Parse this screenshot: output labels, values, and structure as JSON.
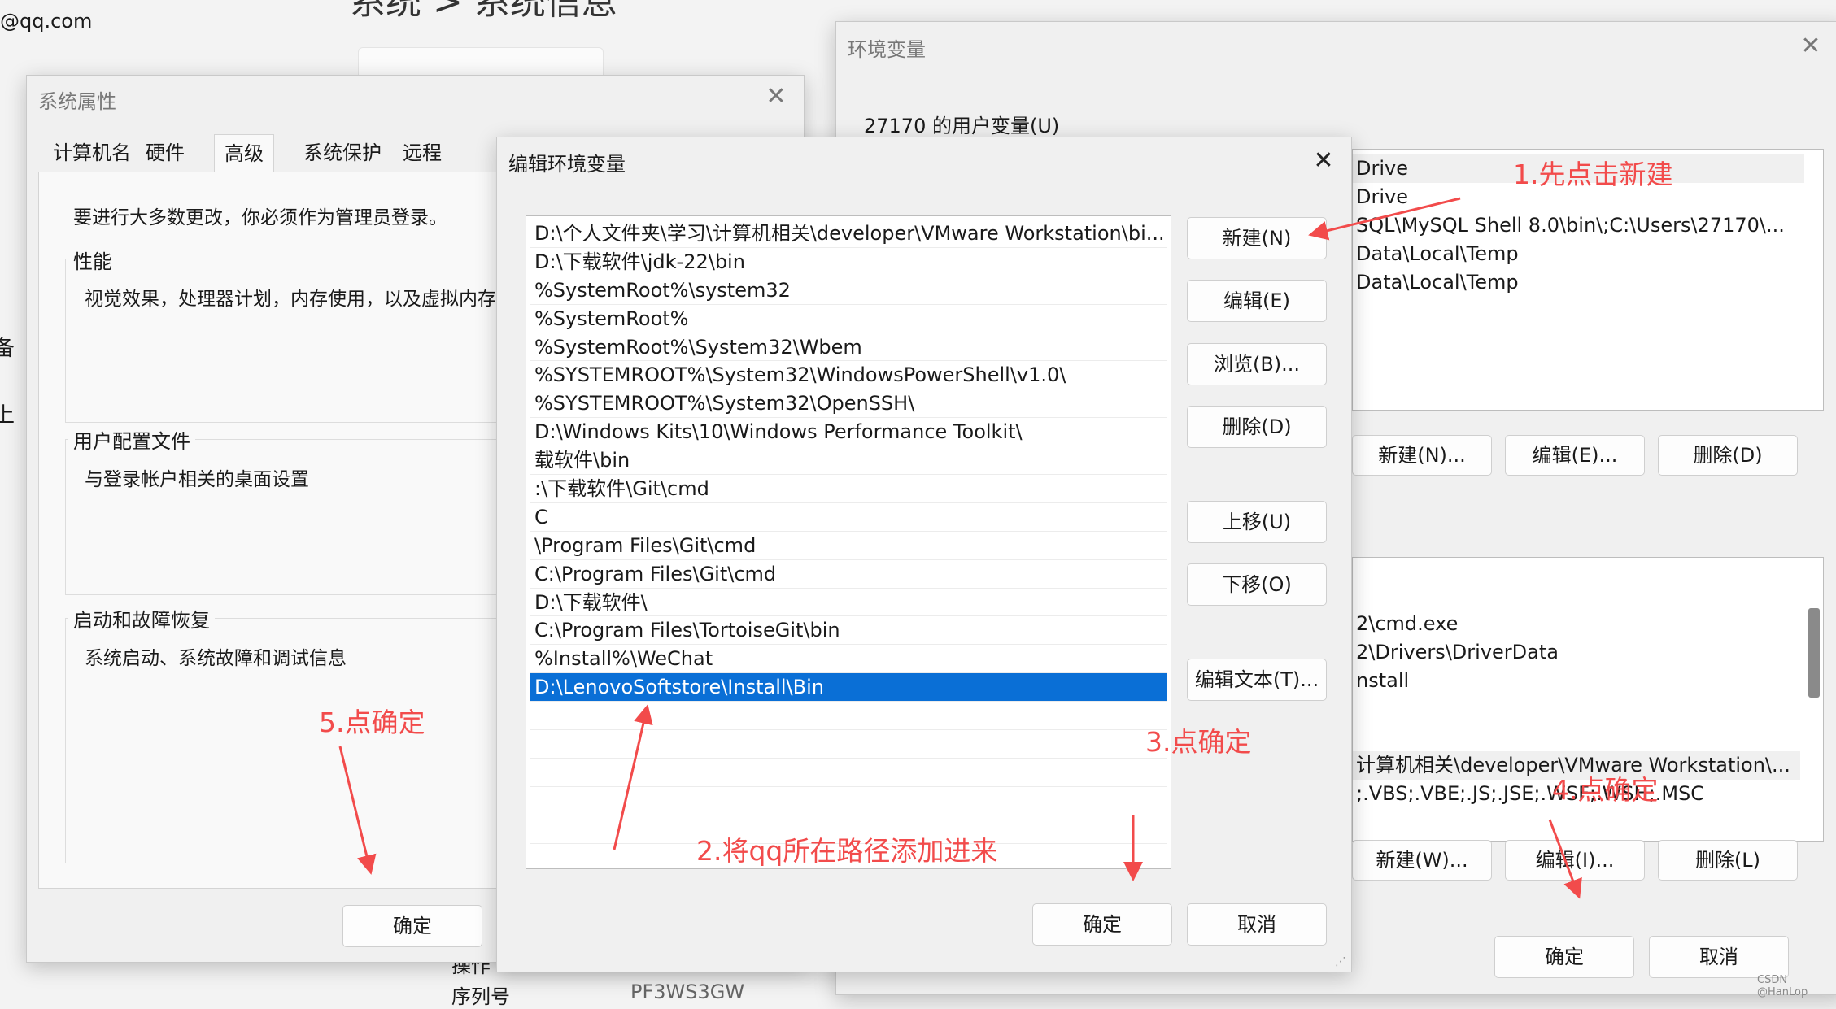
{
  "background": {
    "email_fragment": "@qq.com",
    "heading_fragment": "系统 > 系统信息",
    "side_char_1": "备",
    "side_char_2": "上",
    "bottom_text_1": "操作",
    "bottom_text_2": "序列号",
    "bottom_text_3": "PF3WS3GW"
  },
  "sys_props": {
    "title": "系统属性",
    "tabs": [
      "计算机名",
      "硬件",
      "高级",
      "系统保护",
      "远程"
    ],
    "admin_note": "要进行大多数更改，你必须作为管理员登录。",
    "groups": [
      {
        "title": "性能",
        "desc": "视觉效果，处理器计划，内存使用，以及虚拟内存"
      },
      {
        "title": "用户配置文件",
        "desc": "与登录帐户相关的桌面设置"
      },
      {
        "title": "启动和故障恢复",
        "desc": "系统启动、系统故障和调试信息"
      }
    ],
    "ok_label": "确定"
  },
  "env_vars": {
    "title": "环境变量",
    "user_section_label": "27170 的用户变量(U)",
    "user_rows": [
      "Drive",
      "Drive",
      "SQL\\MySQL Shell 8.0\\bin\\;C:\\Users\\27170\\...",
      "Data\\Local\\Temp",
      "Data\\Local\\Temp"
    ],
    "user_buttons": [
      "新建(N)...",
      "编辑(E)...",
      "删除(D)"
    ],
    "sys_rows": [
      "2\\cmd.exe",
      "2\\Drivers\\DriverData",
      "nstall",
      "",
      "",
      "计算机相关\\developer\\VMware Workstation\\...",
      ";.VBS;.VBE;.JS;.JSE;.WSF;.WSH;.MSC"
    ],
    "sys_buttons": [
      "新建(W)...",
      "编辑(I)...",
      "删除(L)"
    ],
    "ok_label": "确定",
    "cancel_label": "取消"
  },
  "edit_env": {
    "title": "编辑环境变量",
    "paths": [
      "D:\\个人文件夹\\学习\\计算机相关\\developer\\VMware Workstation\\bi...",
      "D:\\下载软件\\jdk-22\\bin",
      "%SystemRoot%\\system32",
      "%SystemRoot%",
      "%SystemRoot%\\System32\\Wbem",
      "%SYSTEMROOT%\\System32\\WindowsPowerShell\\v1.0\\",
      "%SYSTEMROOT%\\System32\\OpenSSH\\",
      "D:\\Windows Kits\\10\\Windows Performance Toolkit\\",
      "载软件\\bin",
      ":\\下载软件\\Git\\cmd",
      "C",
      "\\Program Files\\Git\\cmd",
      "C:\\Program Files\\Git\\cmd",
      "D:\\下载软件\\",
      "C:\\Program Files\\TortoiseGit\\bin",
      "%Install%\\WeChat",
      "D:\\LenovoSoftstore\\Install\\Bin"
    ],
    "selected_index": 16,
    "buttons": {
      "new": "新建(N)",
      "edit": "编辑(E)",
      "browse": "浏览(B)...",
      "delete": "删除(D)",
      "up": "上移(U)",
      "down": "下移(O)",
      "edit_text": "编辑文本(T)..."
    },
    "ok_label": "确定",
    "cancel_label": "取消"
  },
  "annotations": [
    "1.先点击新建",
    "2.将qq所在路径添加进来",
    "3.点确定",
    "4.点确定",
    "5.点确定"
  ],
  "watermark": "CSDN @HanLop",
  "colors": {
    "selection": "#0a6fd6",
    "annotation": "#f24b4b"
  }
}
